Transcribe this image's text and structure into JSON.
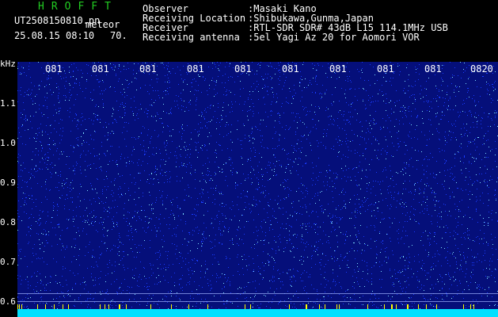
{
  "header": {
    "app_title": "HROFFT",
    "file_name": "UT2508150810.pn",
    "meteor_label": "meteor",
    "datetime": "25.08.15 08:10",
    "scale_value": "70.",
    "info": [
      {
        "key": "Observer",
        "value": ":Masaki Kano"
      },
      {
        "key": "Receiving Location",
        "value": ":Shibukawa,Gunma,Japan"
      },
      {
        "key": "Receiver",
        "value": ":RTL-SDR SDR# 43dB L15 114.1MHz USB"
      },
      {
        "key": "Receiving antenna",
        "value": ":5el Yagi Az 20 for Aomori VOR"
      }
    ]
  },
  "spectrogram": {
    "unit_label": "kHz",
    "freq_ticks": [
      "1.1",
      "1.0",
      "0.9",
      "0.8",
      "0.7",
      "0.6"
    ],
    "time_ticks": [
      "081",
      "081",
      "081",
      "081",
      "081",
      "081",
      "081",
      "081",
      "081",
      "0820"
    ],
    "colors": {
      "background": "#050f7a",
      "noise_low": "#1a3cff",
      "noise_high": "#7fe0ff",
      "bottom_bar": "#00e0ff",
      "marker": "#ffff00"
    }
  }
}
